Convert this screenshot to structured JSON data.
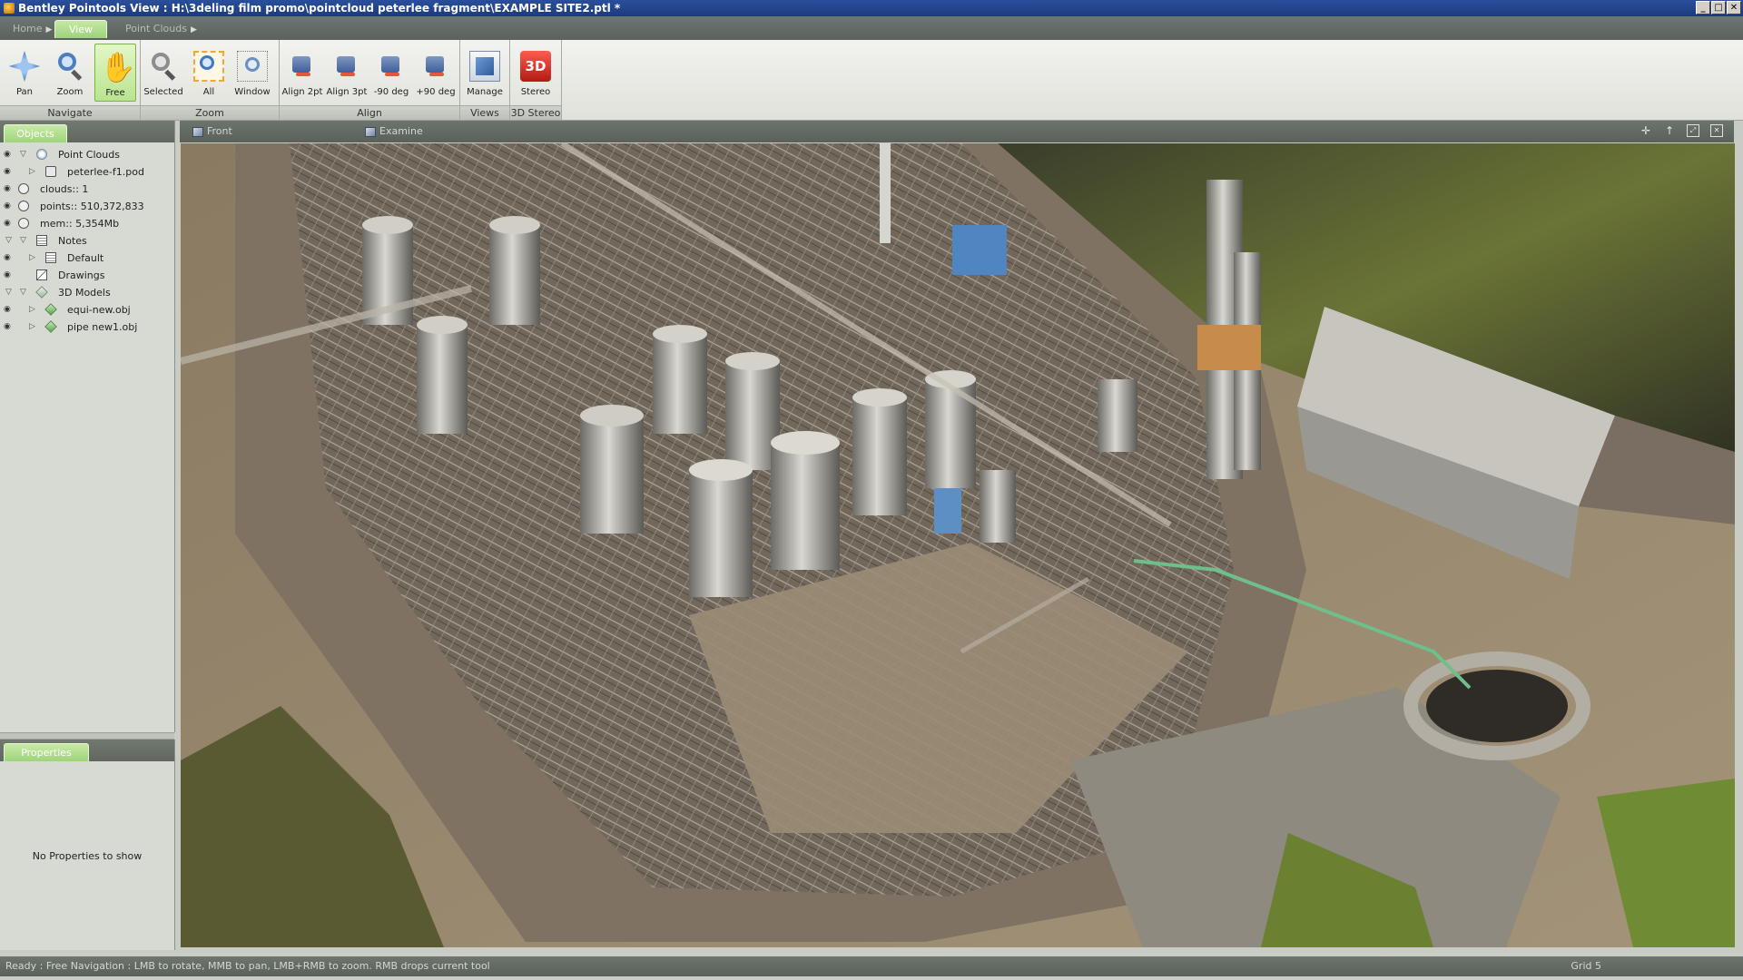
{
  "window": {
    "title": "Bentley Pointools View  :  H:\\3deling film promo\\pointcloud peterlee fragment\\EXAMPLE SITE2.ptl *",
    "controls": [
      "_",
      "□",
      "✕"
    ]
  },
  "ribbon": {
    "tabs": [
      {
        "label": "Home",
        "active": false
      },
      {
        "label": "View",
        "active": true
      },
      {
        "label": "Point Clouds",
        "active": false
      }
    ]
  },
  "toolbar": {
    "groups": [
      {
        "label": "Navigate",
        "buttons": [
          {
            "label": "Pan",
            "icon": "pan-icon",
            "active": false
          },
          {
            "label": "Zoom",
            "icon": "zoom-icon",
            "active": false
          },
          {
            "label": "Free",
            "icon": "hand-icon",
            "active": true
          }
        ]
      },
      {
        "label": "Zoom",
        "buttons": [
          {
            "label": "Selected",
            "icon": "zoom-selected-icon"
          },
          {
            "label": "All",
            "icon": "zoom-all-icon"
          },
          {
            "label": "Window",
            "icon": "zoom-window-icon"
          }
        ]
      },
      {
        "label": "Align",
        "buttons": [
          {
            "label": "Align 2pt",
            "icon": "align-2pt-icon"
          },
          {
            "label": "Align 3pt",
            "icon": "align-3pt-icon"
          },
          {
            "label": "-90 deg",
            "icon": "rotate-minus-90-icon"
          },
          {
            "label": "+90 deg",
            "icon": "rotate-plus-90-icon"
          }
        ]
      },
      {
        "label": "Views",
        "buttons": [
          {
            "label": "Manage",
            "icon": "manage-views-icon"
          }
        ]
      },
      {
        "label": "3D Stereo",
        "buttons": [
          {
            "label": "Stereo",
            "icon": "stereo-3d-icon",
            "icon_text": "3D"
          }
        ]
      }
    ]
  },
  "objects_panel": {
    "tab_label": "Objects",
    "tree": [
      {
        "label": "Point Clouds",
        "icon": "point-cloud-icon",
        "expanded": true
      },
      {
        "label": "peterlee-f1.pod",
        "icon": "pod-file-icon"
      },
      {
        "label": "clouds:: 1",
        "icon": "info-icon"
      },
      {
        "label": "points:: 510,372,833",
        "icon": "info-icon"
      },
      {
        "label": "mem:: 5,354Mb",
        "icon": "info-icon"
      },
      {
        "label": "Notes",
        "icon": "notes-icon",
        "expanded": true
      },
      {
        "label": "Default",
        "icon": "note-icon"
      },
      {
        "label": "Drawings",
        "icon": "drawings-icon"
      },
      {
        "label": "3D Models",
        "icon": "models-icon",
        "expanded": true
      },
      {
        "label": "equi-new.obj",
        "icon": "model-icon"
      },
      {
        "label": "pipe new1.obj",
        "icon": "model-icon"
      }
    ]
  },
  "properties_panel": {
    "tab_label": "Properties",
    "empty_text": "No Properties to show"
  },
  "view_tabs": [
    {
      "label": "Front",
      "icon": "view-front-icon"
    },
    {
      "label": "Examine",
      "icon": "view-examine-icon"
    }
  ],
  "view_controls": [
    {
      "glyph": "✛",
      "icon": "add-view-icon"
    },
    {
      "glyph": "↑",
      "icon": "up-icon"
    },
    {
      "glyph": "⤢",
      "icon": "maximize-view-icon"
    },
    {
      "glyph": "✕",
      "icon": "close-view-icon"
    }
  ],
  "statusbar": {
    "message": "Ready : Free Navigation : LMB to rotate, MMB to pan, LMB+RMB to zoom. RMB drops current tool",
    "grid": "Grid 5"
  },
  "colors": {
    "accent_green": "#a4d57f",
    "titlebar_blue": "#1c3b7d",
    "panel_bg": "#d7dad3"
  }
}
